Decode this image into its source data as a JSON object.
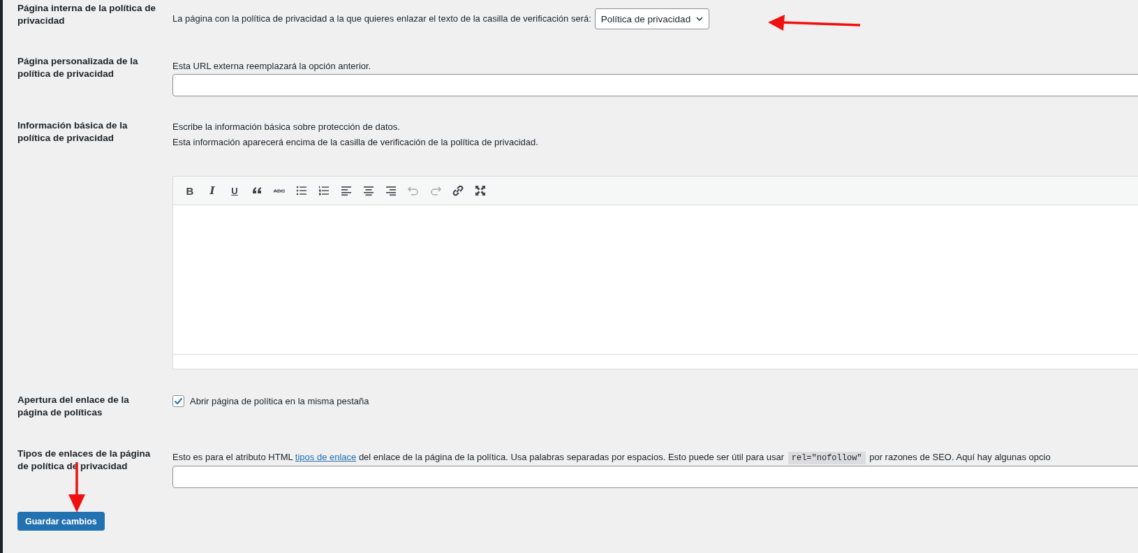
{
  "settings": [
    {
      "kind": "select",
      "label": "Página interna de la política de privacidad",
      "description": "La página con la política de privacidad a la que quieres enlazar el texto de la casilla de verificación será:",
      "value": "Política de privacidad",
      "arrow_marked": true
    },
    {
      "kind": "url",
      "label": "Página personalizada de la política de privacidad",
      "description": "Esta URL externa reemplazará la opción anterior."
    },
    {
      "kind": "editor",
      "label": "Información básica de la política de privacidad",
      "description_lines": [
        "Escribe la información básica sobre protección de datos.",
        "Esta información aparecerá encima de la casilla de verificación de la política de privacidad."
      ],
      "toolbar": [
        {
          "kind": "bold",
          "label": "B",
          "disabled": false
        },
        {
          "kind": "italic",
          "label": "I",
          "disabled": false
        },
        {
          "kind": "underline",
          "label": "U",
          "disabled": false
        },
        {
          "kind": "quote",
          "disabled": false
        },
        {
          "kind": "strike",
          "label": "ABC",
          "disabled": false
        },
        {
          "kind": "bullets",
          "disabled": false
        },
        {
          "kind": "numbers",
          "disabled": false
        },
        {
          "kind": "align-left",
          "disabled": false
        },
        {
          "kind": "align-center",
          "disabled": false
        },
        {
          "kind": "align-right",
          "disabled": false
        },
        {
          "kind": "undo",
          "disabled": true
        },
        {
          "kind": "redo",
          "disabled": true
        },
        {
          "kind": "link",
          "disabled": false
        },
        {
          "kind": "fullscreen",
          "disabled": false
        }
      ]
    },
    {
      "kind": "checkbox",
      "label": "Apertura del enlace de la página de políticas",
      "checkbox_label": "Abrir página de política en la misma pestaña",
      "checked": true
    },
    {
      "kind": "text",
      "label": "Tipos de enlaces de la página de política de privacidad",
      "description_parts": [
        {
          "kind": "text",
          "text": "Esto es para el atributo HTML "
        },
        {
          "kind": "link",
          "text": "tipos de enlace"
        },
        {
          "kind": "text",
          "text": " del enlace de la página de la política. Usa palabras separadas por espacios. Esto puede ser útil para usar "
        },
        {
          "kind": "code",
          "text": "rel=\"nofollow\""
        },
        {
          "kind": "text",
          "text": " por razones de SEO. Aquí hay algunas opcio"
        }
      ]
    }
  ],
  "save_button": {
    "label": "Guardar cambios",
    "arrow_marked": true
  }
}
